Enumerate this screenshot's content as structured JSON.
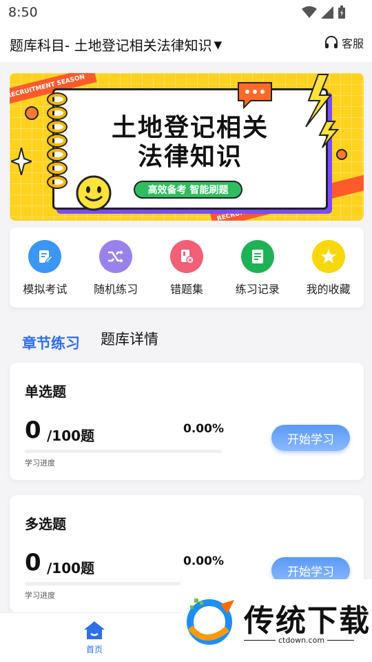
{
  "status_bar": {
    "time": "8:50"
  },
  "header": {
    "subject_title": "题库科目- 土地登记相关法律知识",
    "service_label": "客服"
  },
  "banner": {
    "title_line1": "土地登记相关",
    "title_line2": "法律知识",
    "tag": "高效备考  智能刷题",
    "ribbon_text": "RECRUITMENT SEASON"
  },
  "quick_nav": [
    {
      "label": "模拟考试",
      "icon": "exam-edit-icon",
      "color": "#3b96f5"
    },
    {
      "label": "随机练习",
      "icon": "shuffle-icon",
      "color": "#9a82ec"
    },
    {
      "label": "错题集",
      "icon": "error-file-icon",
      "color": "#f25f76"
    },
    {
      "label": "练习记录",
      "icon": "record-doc-icon",
      "color": "#1fb156"
    },
    {
      "label": "我的收藏",
      "icon": "star-icon",
      "color": "#f8d80a"
    }
  ],
  "tabs": [
    {
      "label": "章节练习",
      "active": true
    },
    {
      "label": "题库详情",
      "active": false
    }
  ],
  "cards": [
    {
      "title": "单选题",
      "done": "0",
      "total": "/100题",
      "percent": "0.00%",
      "progress": 0,
      "progress_label": "学习进度",
      "button": "开始学习"
    },
    {
      "title": "多选题",
      "done": "0",
      "total": "/100题",
      "percent": "0.00%",
      "progress": 0,
      "progress_label": "学习进度",
      "button": "开始学习"
    }
  ],
  "bottom_nav": {
    "home_label": "首页"
  },
  "watermark": {
    "brand": "传统下载",
    "url": "ctdown.com"
  },
  "colors": {
    "accent": "#2f6fe8",
    "banner_bg": "#ffd21f"
  }
}
